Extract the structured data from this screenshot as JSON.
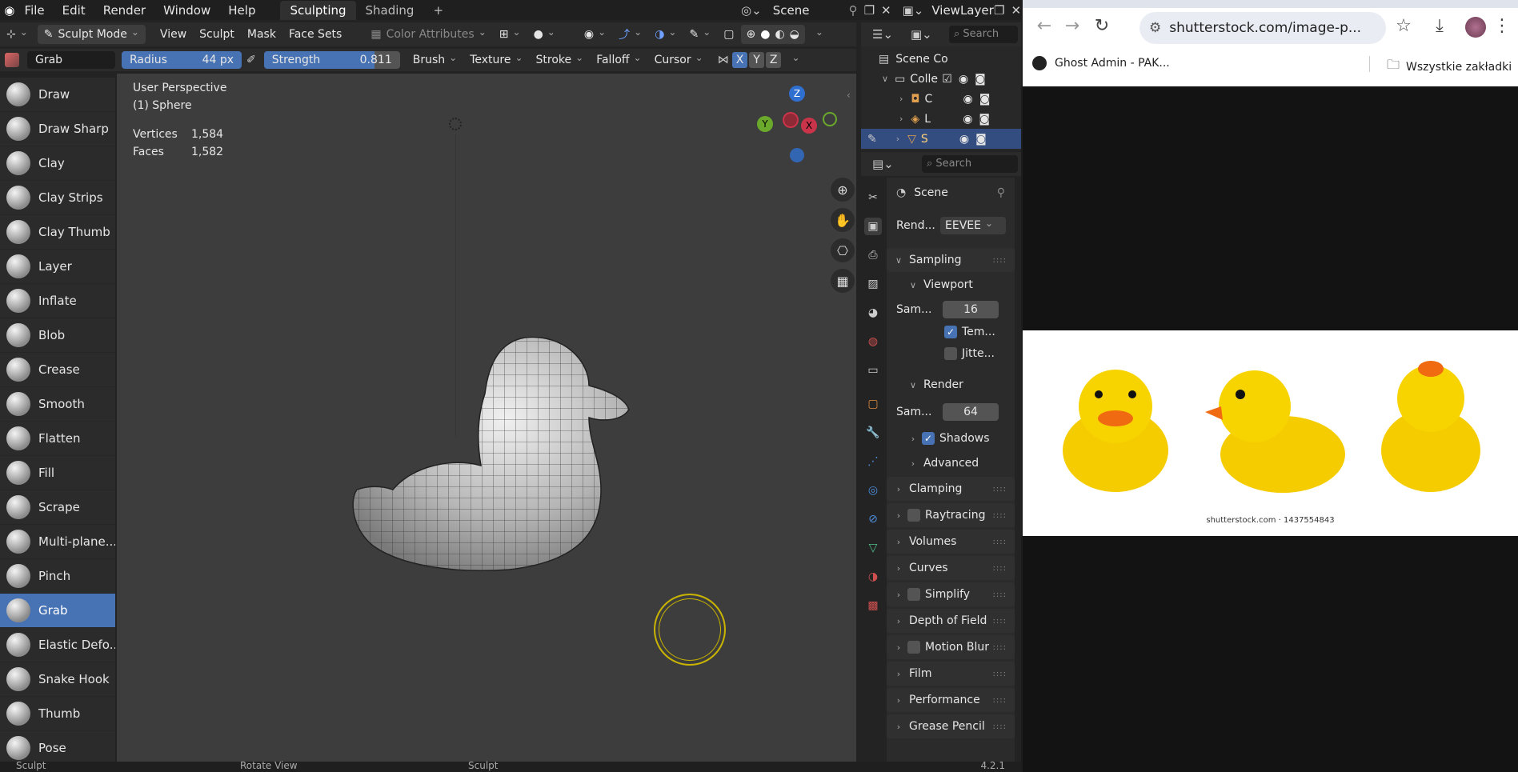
{
  "topbar": {
    "menus": [
      "File",
      "Edit",
      "Render",
      "Window",
      "Help"
    ],
    "workspaces": [
      "Sculpting",
      "Shading"
    ],
    "add_workspace": "+",
    "scene": "Scene",
    "view_layer": "ViewLayer"
  },
  "header": {
    "mode": "Sculpt Mode",
    "menus": [
      "View",
      "Sculpt",
      "Mask",
      "Face Sets"
    ],
    "color_attributes": "Color Attributes"
  },
  "tool_settings": {
    "brush_name": "Grab",
    "radius_label": "Radius",
    "radius_value": "44 px",
    "strength_label": "Strength",
    "strength_value": "0.811",
    "strength_fraction": 0.811,
    "brush": "Brush",
    "texture": "Texture",
    "stroke": "Stroke",
    "falloff": "Falloff",
    "cursor": "Cursor",
    "axes": [
      "X",
      "Y",
      "Z"
    ]
  },
  "tools": [
    {
      "label": "Draw"
    },
    {
      "label": "Draw Sharp"
    },
    {
      "label": "Clay"
    },
    {
      "label": "Clay Strips"
    },
    {
      "label": "Clay Thumb"
    },
    {
      "label": "Layer"
    },
    {
      "label": "Inflate"
    },
    {
      "label": "Blob"
    },
    {
      "label": "Crease"
    },
    {
      "label": "Smooth"
    },
    {
      "label": "Flatten"
    },
    {
      "label": "Fill"
    },
    {
      "label": "Scrape"
    },
    {
      "label": "Multi-plane..."
    },
    {
      "label": "Pinch"
    },
    {
      "label": "Grab",
      "active": true
    },
    {
      "label": "Elastic Defo..."
    },
    {
      "label": "Snake Hook"
    },
    {
      "label": "Thumb"
    },
    {
      "label": "Pose"
    }
  ],
  "viewport": {
    "perspective": "User Perspective",
    "object": "(1) Sphere",
    "vertices_label": "Vertices",
    "vertices_value": "1,584",
    "faces_label": "Faces",
    "faces_value": "1,582",
    "gizmo_axes": [
      "Z",
      "Y",
      "X"
    ]
  },
  "outliner": {
    "search_placeholder": "Search",
    "rows": [
      "Scene Co",
      "Colle",
      "C",
      "L",
      "S"
    ]
  },
  "properties": {
    "search_placeholder": "Search",
    "scene": "Scene",
    "render_engine_label": "Rend...",
    "render_engine": "EEVEE",
    "sampling": "Sampling",
    "viewport": "Viewport",
    "viewport_samples_label": "Sam...",
    "viewport_samples": "16",
    "temporal": "Tem...",
    "jitter": "Jitte...",
    "render": "Render",
    "render_samples_label": "Sam...",
    "render_samples": "64",
    "shadows": "Shadows",
    "advanced": "Advanced",
    "panels": [
      "Clamping",
      "Raytracing",
      "Volumes",
      "Curves",
      "Simplify",
      "Depth of Field",
      "Motion Blur",
      "Film",
      "Performance",
      "Grease Pencil"
    ]
  },
  "statusbar": {
    "left": "Sculpt",
    "mid": "Rotate View",
    "right": "Sculpt",
    "version": "4.2.1"
  },
  "browser": {
    "url": "shutterstock.com/image-p...",
    "bookmark1": "Ghost Admin - PAK...",
    "bookmark2": "Wszystkie zakładki",
    "caption": "shutterstock.com · 1437554843"
  },
  "colors": {
    "accent": "#4772b3",
    "viewport_bg": "#3d3d3d",
    "duck_yellow": "#f7d000"
  }
}
